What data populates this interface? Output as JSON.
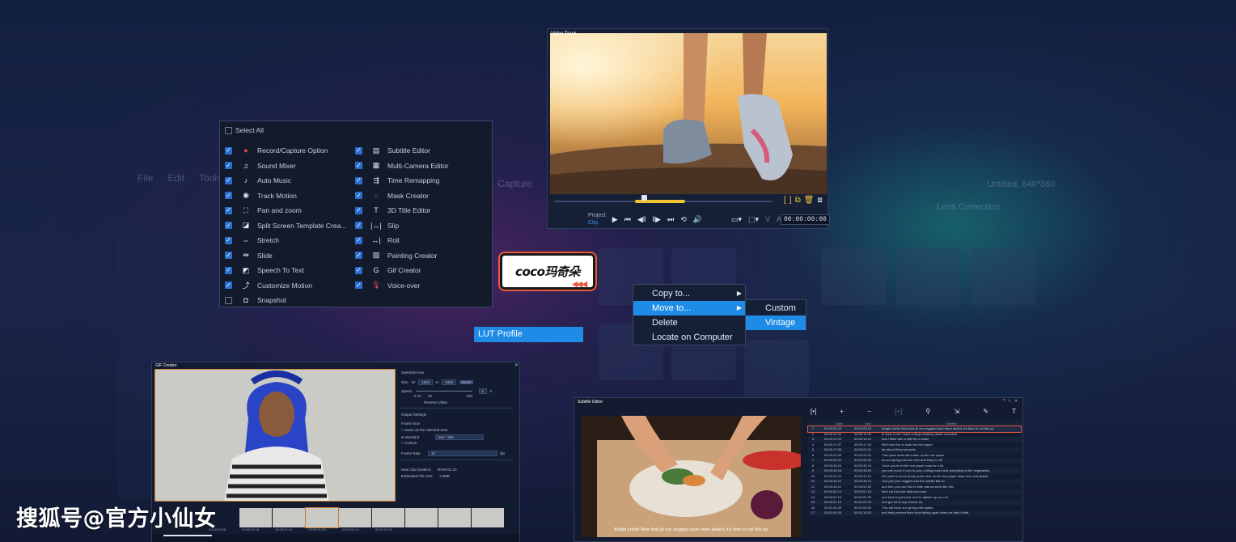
{
  "background_editor": {
    "menu": [
      "File",
      "Edit",
      "Tools"
    ],
    "capture_label": "Capture",
    "project_title": "Untitled, 640*360",
    "lens_label": "Lens Correction"
  },
  "checklist": {
    "select_all": "Select All",
    "left_items": [
      {
        "label": "Record/Capture Option",
        "checked": true,
        "icon": "record-icon"
      },
      {
        "label": "Sound Mixer",
        "checked": true,
        "icon": "sound-mixer-icon"
      },
      {
        "label": "Auto Music",
        "checked": true,
        "icon": "auto-music-icon"
      },
      {
        "label": "Track Motion",
        "checked": true,
        "icon": "track-motion-icon"
      },
      {
        "label": "Pan and zoom",
        "checked": true,
        "icon": "pan-zoom-icon"
      },
      {
        "label": "Split Screen Template Crea...",
        "checked": true,
        "icon": "split-screen-icon"
      },
      {
        "label": "Stretch",
        "checked": true,
        "icon": "stretch-icon"
      },
      {
        "label": "Slide",
        "checked": true,
        "icon": "slide-icon"
      },
      {
        "label": "Speech To Text",
        "checked": true,
        "icon": "speech-text-icon"
      },
      {
        "label": "Customize Motion",
        "checked": true,
        "icon": "customize-motion-icon"
      },
      {
        "label": "Snapshot",
        "checked": false,
        "icon": "snapshot-icon"
      }
    ],
    "right_items": [
      {
        "label": "Subtitle Editor",
        "checked": true,
        "icon": "subtitle-icon"
      },
      {
        "label": "Multi-Camera Editor",
        "checked": true,
        "icon": "multicam-icon"
      },
      {
        "label": "Time Remapping",
        "checked": true,
        "icon": "time-remap-icon"
      },
      {
        "label": "Mask Creator",
        "checked": true,
        "icon": "mask-icon"
      },
      {
        "label": "3D Title Editor",
        "checked": true,
        "icon": "3d-title-icon"
      },
      {
        "label": "Slip",
        "checked": true,
        "icon": "slip-icon"
      },
      {
        "label": "Roll",
        "checked": true,
        "icon": "roll-icon"
      },
      {
        "label": "Painting Creator",
        "checked": true,
        "icon": "painting-icon"
      },
      {
        "label": "Gif Creator",
        "checked": true,
        "icon": "gif-icon"
      },
      {
        "label": "Voice-over",
        "checked": true,
        "icon": "microphone-icon"
      }
    ]
  },
  "player": {
    "title": "Video Track",
    "project_label": "Project",
    "clip_label": "Clip",
    "timecode": "00:00:00:00",
    "scrub_position": 0.4
  },
  "badge": {
    "text": "coco玛奇朵",
    "arrows": "◀◀◀"
  },
  "context_menu": {
    "items": [
      "Copy to...",
      "Move to...",
      "Delete",
      "Locate on Computer"
    ],
    "highlighted": "Move to...",
    "submenu": [
      "Custom",
      "Vintage"
    ],
    "submenu_highlighted": "Vintage"
  },
  "lut_profile": "LUT Profile",
  "gif_creator": {
    "title": "GIF Creator",
    "selected_area": "Selected Area",
    "size_label": "Size",
    "w_label": "W:",
    "w_value": "1920",
    "h_label": "H:",
    "h_value": "1080",
    "reset": "Reset",
    "speed_label": "Speed",
    "speed_value": "1",
    "speed_unit": "X",
    "speed_ticks": [
      "0.10",
      "1X",
      "10X"
    ],
    "reverse": "Reverse Video",
    "output_settings": "Output Settings",
    "frame_size": "Frame Size",
    "same_as": "Same as the selected area",
    "standard": "Standard",
    "standard_value": "640 * 360",
    "custom": "Custom",
    "frame_rate": "Frame Rate",
    "frame_rate_value": "10",
    "fps": "fps",
    "new_clip_duration_label": "New Clip Duration:",
    "new_clip_duration": "00:00:01.10",
    "est_size_label": "Estimated File Size:",
    "est_size": "1.0MB",
    "film_labels": [
      "00:00:00:08",
      "00:00:00:16",
      "00:00:01:00",
      "00:00:01:08",
      "00:00:01:16",
      "00:00:02:00"
    ]
  },
  "subtitle_editor": {
    "title": "Subtitle Editor",
    "caption": "Alright chefs! Now that all our veggies have been added, it's time to roll this up",
    "columns": [
      "",
      "Start",
      "End",
      "Subtitle"
    ],
    "rows": [
      [
        "1",
        "00:00:00.15",
        "00:00:03.15",
        "Alright chefs! Now that all our veggies have been added, it's time to roll this up"
      ],
      [
        "2",
        "00:00:11.02",
        "00:00:11.03",
        "In front of me I have a large shallow plastic container"
      ],
      [
        "3",
        "00:00:11.03",
        "00:00:16.10",
        "that I filled with a little bit of water"
      ],
      [
        "4",
        "00:00:17.07",
        "00:00:17.00",
        "We'll use this to soak the rice paper"
      ],
      [
        "5",
        "00:00:17.08",
        "00:00:21.01",
        "for about thirty seconds"
      ],
      [
        "6",
        "00:00:22.09",
        "00:00:22.01",
        "This quick soak will soften up the rice paper"
      ],
      [
        "7",
        "00:00:22.01",
        "00:00:26.09",
        "so our spring rolls are nice and easy to roll"
      ],
      [
        "8",
        "00:00:25.04",
        "00:00:30.14",
        "Once you're let the rice paper soak for a bit,"
      ],
      [
        "9",
        "00:00:35.18",
        "00:00:35.09",
        "you can move it over to your cutting board and start piling in the vegetables"
      ],
      [
        "10",
        "00:00:37.24",
        "00:00:42.12",
        "We want to move pretty quick here so the rice paper stays nice and pliable"
      ],
      [
        "11",
        "00:00:44.22",
        "00:00:46.10",
        "Just pile your veggies into the middle like so"
      ],
      [
        "12",
        "00:00:45.21",
        "00:00:51.02",
        "and then you can fold in both narrow ends like this"
      ],
      [
        "13",
        "00:00:54.13",
        "00:00:57.15",
        "then roll fold one wide end over"
      ],
      [
        "14",
        "00:00:57.15",
        "00:00:57.09",
        "and kind of pull back on it to tighten up our roll"
      ],
      [
        "15",
        "00:00:57.19",
        "00:01:00.03",
        "and get rid of any excess air,"
      ],
      [
        "16",
        "00:01:04.29",
        "00:01:09.00",
        "This will keep our spring rolls tighter,"
      ],
      [
        "17",
        "00:01:05.00",
        "00:01:10.03",
        "and help prevent them from falling apart when we take a bite."
      ]
    ],
    "selected_row": 0
  },
  "watermark": "搜狐号@官方小仙女"
}
